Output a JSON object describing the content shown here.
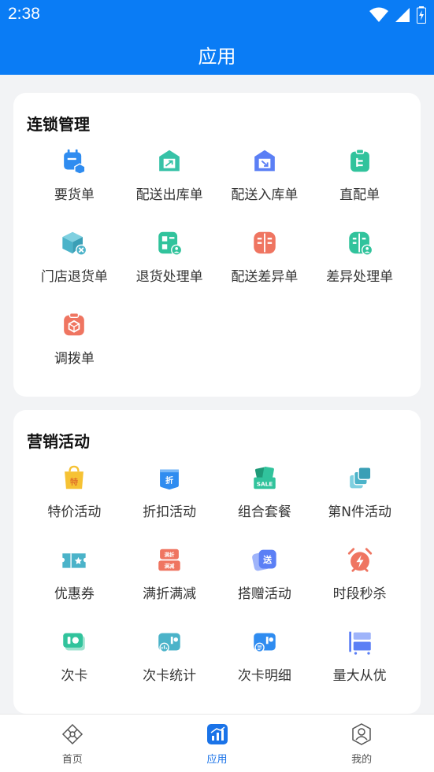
{
  "status_bar": {
    "time": "2:38"
  },
  "header": {
    "title": "应用"
  },
  "sections": [
    {
      "title": "连锁管理",
      "items": [
        {
          "label": "要货单",
          "icon": "cart-order-icon",
          "color": "#2f8cf0"
        },
        {
          "label": "配送出库单",
          "icon": "warehouse-out-icon",
          "color": "#37c2a7"
        },
        {
          "label": "配送入库单",
          "icon": "warehouse-in-icon",
          "color": "#5b7ff5"
        },
        {
          "label": "直配单",
          "icon": "clipboard-tree-icon",
          "color": "#31c39c"
        },
        {
          "label": "门店退货单",
          "icon": "box-return-icon",
          "color": "#4bb3c9"
        },
        {
          "label": "退货处理单",
          "icon": "return-process-icon",
          "color": "#31c39c"
        },
        {
          "label": "配送差异单",
          "icon": "book-diff-icon",
          "color": "#ef7561"
        },
        {
          "label": "差异处理单",
          "icon": "diff-process-icon",
          "color": "#31c39c"
        },
        {
          "label": "调拨单",
          "icon": "transfer-clipboard-icon",
          "color": "#ef7561"
        }
      ]
    },
    {
      "title": "营销活动",
      "items": [
        {
          "label": "特价活动",
          "icon": "special-price-bag-icon",
          "color": "#f6c234"
        },
        {
          "label": "折扣活动",
          "icon": "discount-icon",
          "color": "#2f8cf0"
        },
        {
          "label": "组合套餐",
          "icon": "combo-sale-icon",
          "color": "#31c39c"
        },
        {
          "label": "第N件活动",
          "icon": "nth-item-icon",
          "color": "#4bb3c9"
        },
        {
          "label": "优惠券",
          "icon": "coupon-icon",
          "color": "#4bb3c9"
        },
        {
          "label": "满折满减",
          "icon": "full-reduction-icon",
          "color": "#ef7561"
        },
        {
          "label": "搭赠活动",
          "icon": "gift-send-icon",
          "color": "#5b7ff5"
        },
        {
          "label": "时段秒杀",
          "icon": "flash-sale-clock-icon",
          "color": "#ef7561"
        },
        {
          "label": "次卡",
          "icon": "times-card-icon",
          "color": "#31c39c"
        },
        {
          "label": "次卡统计",
          "icon": "card-stats-icon",
          "color": "#4bb3c9"
        },
        {
          "label": "次卡明细",
          "icon": "card-detail-icon",
          "color": "#2f8cf0"
        },
        {
          "label": "量大从优",
          "icon": "bulk-discount-icon",
          "color": "#5b7ff5"
        }
      ]
    }
  ],
  "bottom_nav": [
    {
      "label": "首页",
      "icon": "home-diamond-icon",
      "active": false
    },
    {
      "label": "应用",
      "icon": "apps-chart-icon",
      "active": true
    },
    {
      "label": "我的",
      "icon": "profile-shield-icon",
      "active": false
    }
  ]
}
